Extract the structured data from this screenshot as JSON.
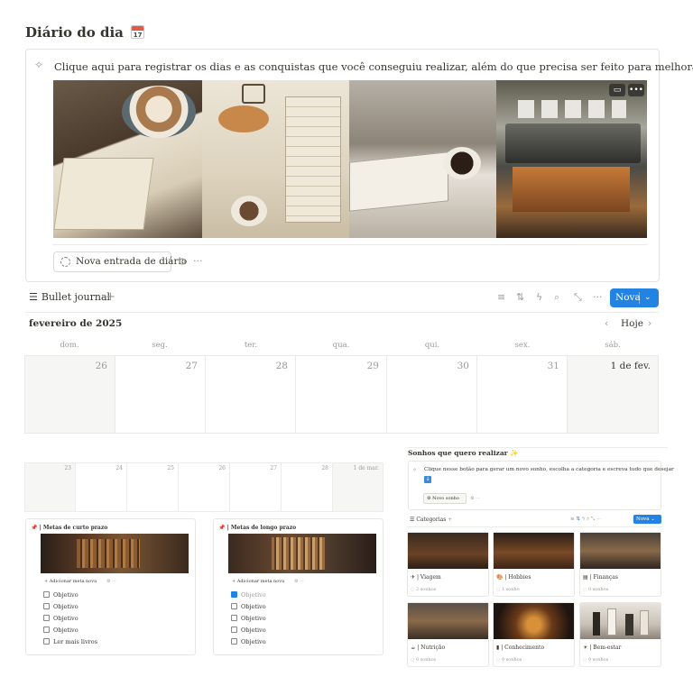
{
  "page": {
    "title": "Diário do dia",
    "title_emoji_day": "17"
  },
  "callout": {
    "text": "Clique aqui para registrar os dias e as conquistas que você conseguiu realizar, além do que precisa ser feito para melhorar.",
    "new_entry_label": "Nova entrada de diário"
  },
  "database": {
    "title": "Bullet journal",
    "new_button": "Nova",
    "month": "fevereiro de 2025",
    "today_label": "Hoje",
    "weekdays": [
      "dom.",
      "seg.",
      "ter.",
      "qua.",
      "qui.",
      "sex.",
      "sáb."
    ],
    "days": [
      "26",
      "27",
      "28",
      "29",
      "30",
      "31",
      "1 de fev."
    ]
  },
  "mini_calendar": {
    "days": [
      "23",
      "24",
      "25",
      "26",
      "27",
      "28",
      "1 de mar."
    ]
  },
  "short_goals": {
    "title": "| Metas de curto prazo",
    "add_label": "Adicionar meta nova",
    "items": [
      {
        "label": "Objetivo",
        "checked": false
      },
      {
        "label": "Objetivo",
        "checked": false
      },
      {
        "label": "Objetivo",
        "checked": false
      },
      {
        "label": "Objetivo",
        "checked": false
      },
      {
        "label": "Ler mais livros",
        "checked": false
      }
    ]
  },
  "long_goals": {
    "title": "| Metas de longo prazo",
    "add_label": "Adicionar meta nova",
    "items": [
      {
        "label": "Objetivo",
        "checked": true
      },
      {
        "label": "Objetivo",
        "checked": false
      },
      {
        "label": "Objetivo",
        "checked": false
      },
      {
        "label": "Objetivo",
        "checked": false
      },
      {
        "label": "Objetivo",
        "checked": false
      }
    ]
  },
  "dreams": {
    "title": "Sonhos que quero realizar",
    "callout_text": "Clique nesse botão para gerar um novo sonho, escolha a categoria e escreva tudo que desejar",
    "new_dream_label": "Novo sonho",
    "db_title": "Categorias",
    "new_button": "Nova",
    "categories": [
      {
        "icon": "plane-icon",
        "glyph": "✈",
        "label": "| Viagem",
        "count": "2 sonhos"
      },
      {
        "icon": "palette-icon",
        "glyph": "🎨",
        "label": "| Hobbies",
        "count": "1 sonho"
      },
      {
        "icon": "money-icon",
        "glyph": "▤",
        "label": "| Finanças",
        "count": "0 sonhos"
      },
      {
        "icon": "food-icon",
        "glyph": "☕",
        "label": "| Nutrição",
        "count": "0 sonhos"
      },
      {
        "icon": "book-icon",
        "glyph": "▮",
        "label": "| Conhecimento",
        "count": "0 sonhos"
      },
      {
        "icon": "sun-icon",
        "glyph": "☀",
        "label": "| Bem-estar",
        "count": "0 sonhos"
      }
    ]
  },
  "colors": {
    "accent": "#2383e2",
    "text": "#37352f",
    "muted": "#9b9a97",
    "border": "#e9e9e7",
    "grey_day": "#f6f6f5"
  }
}
